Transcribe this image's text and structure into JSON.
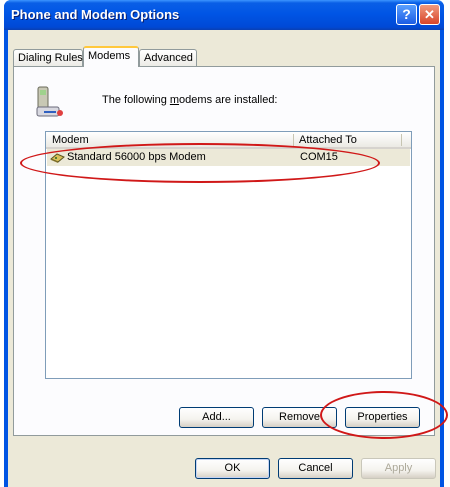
{
  "window": {
    "title": "Phone and Modem Options"
  },
  "tabs": [
    {
      "label": "Dialing Rules"
    },
    {
      "label": "Modems"
    },
    {
      "label": "Advanced"
    }
  ],
  "intro": {
    "prefix": "The following ",
    "underlined": "m",
    "suffix": "odems are  installed:"
  },
  "modem_list": {
    "columns": [
      "Modem",
      "Attached To"
    ],
    "rows": [
      {
        "modem": "Standard 56000 bps Modem",
        "attached_to": "COM15"
      }
    ]
  },
  "panel_buttons": {
    "add": "Add...",
    "remove": "Remove",
    "properties": "Properties"
  },
  "dialog_buttons": {
    "ok": "OK",
    "cancel": "Cancel",
    "apply": "Apply"
  },
  "annotation_color": "#d01818"
}
